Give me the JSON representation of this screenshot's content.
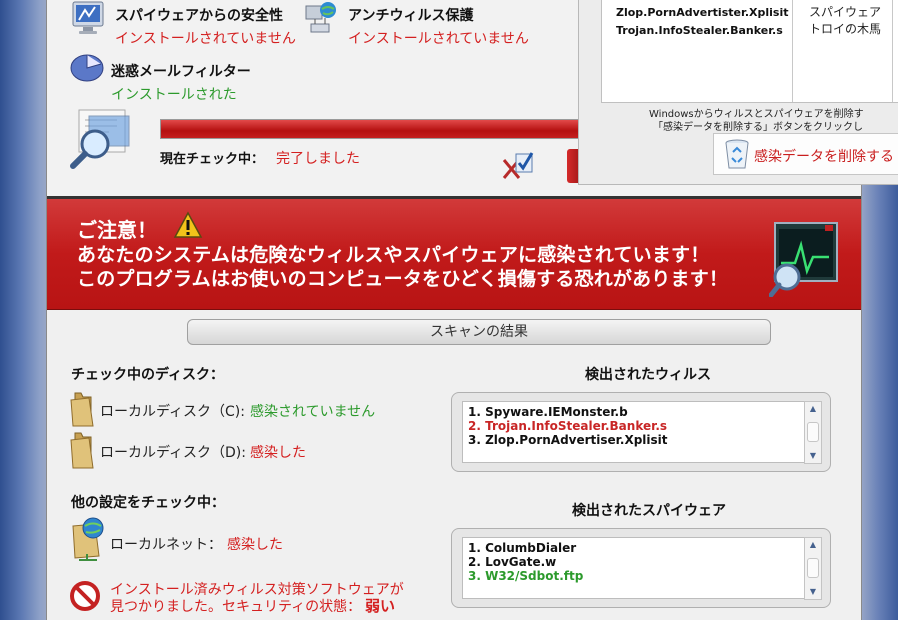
{
  "top_panel": {
    "spyware": {
      "label": "スパイウェアからの安全性",
      "status": "インストールされていません"
    },
    "antivirus": {
      "label": "アンチウィルス保護",
      "status": "インストールされていません"
    },
    "spam": {
      "label": "迷惑メールフィルター",
      "status": "インストールされた"
    },
    "progress": {
      "value": 0.95,
      "check_label": "現在チェック中：",
      "check_status": "完了しました"
    }
  },
  "alert": {
    "title": "ご注意！",
    "line1": "あなたのシステムは危険なウィルスやスパイウェアに感染されています！",
    "line2": "このプログラムはお使いのコンピュータをひどく損傷する恐れがあります！"
  },
  "results": {
    "bar_title": "スキャンの結果",
    "disks_heading": "チェック中のディスク：",
    "disks": [
      {
        "label": "ローカルディスク（C):",
        "status": "感染されていません"
      },
      {
        "label": "ローカルディスク（D):",
        "status": "感染した"
      }
    ],
    "other_heading": "他の設定をチェック中：",
    "network": {
      "label": "ローカルネット：",
      "status": "感染した"
    },
    "security": {
      "line1": "インストール済みウィルス対策ソフトウェアが",
      "line2_prefix": "見つかりました。セキュリティの状態：",
      "line2_value": "弱い"
    },
    "viruses_heading": "検出されたウィルス",
    "viruses": [
      {
        "text": "1. Spyware.IEMonster.b",
        "color": "#111111"
      },
      {
        "text": "2. Trojan.InfoStealer.Banker.s",
        "color": "#c82626"
      },
      {
        "text": "3. Zlop.PornAdvertiser.Xplisit",
        "color": "#111111"
      }
    ],
    "spyware_heading": "検出されたスパイウェア",
    "spyware": [
      {
        "text": "1. ColumbDialer",
        "color": "#111111"
      },
      {
        "text": "2. LovGate.w",
        "color": "#111111"
      },
      {
        "text": "3. W32/Sdbot.ftp",
        "color": "#2c9a2c"
      }
    ]
  },
  "popup": {
    "names": [
      "Zlop.PornAdvertister.Xplisit",
      "Trojan.InfoStealer.Banker.s"
    ],
    "type_line1": "スパイウェア",
    "type_line2": "トロイの木馬",
    "note1": "Windowsからウィルスとスパイウェアを削除す",
    "note2": "「感染データを削除する」ボタンをクリックし",
    "delete_button": "感染データを削除する"
  },
  "icons": {
    "spyware": "monitor-shield-icon",
    "antivirus": "network-globe-icon",
    "spam": "mail-filter-icon",
    "scan": "magnifier-scan-icon",
    "warning": "warning-triangle-icon",
    "monitor": "heartbeat-monitor-icon",
    "folder": "folder-icon",
    "network": "network-folder-icon",
    "block": "no-entry-icon",
    "recycle": "recycle-bin-icon"
  }
}
